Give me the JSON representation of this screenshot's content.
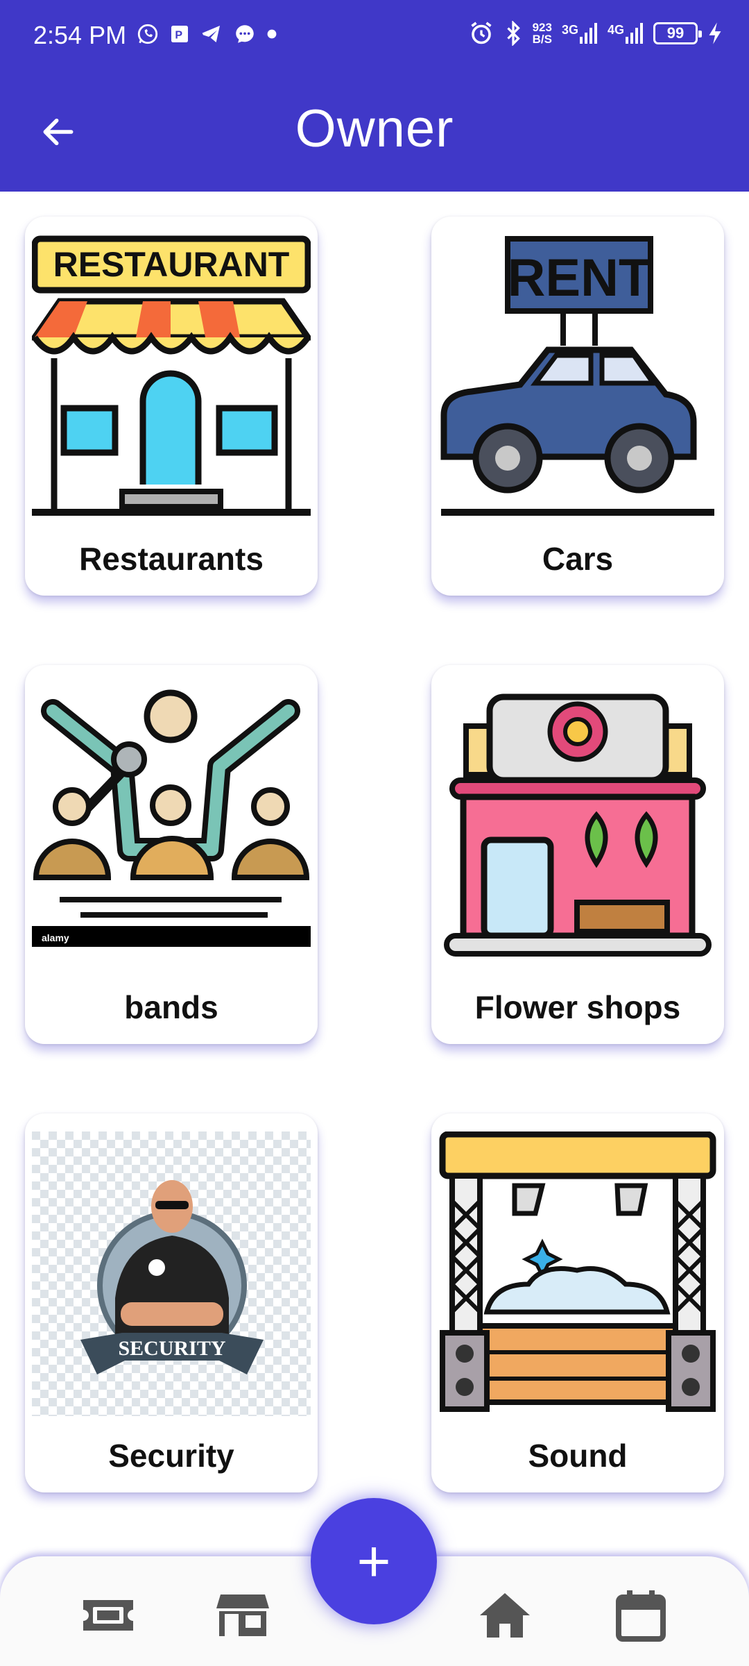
{
  "status_bar": {
    "time": "2:54 PM",
    "net_speed_value": "923",
    "net_speed_unit": "B/S",
    "network_1": "3G",
    "network_2": "4G",
    "battery": "99"
  },
  "app_bar": {
    "title": "Owner",
    "back_icon": "arrow-left-icon"
  },
  "categories": [
    {
      "label": "Restaurants",
      "icon": "restaurant-illustration"
    },
    {
      "label": "Cars",
      "icon": "car-rent-illustration"
    },
    {
      "label": "bands",
      "icon": "band-illustration"
    },
    {
      "label": "Flower shops",
      "icon": "flower-shop-illustration"
    },
    {
      "label": "Security",
      "icon": "security-guard-illustration"
    },
    {
      "label": "Sound",
      "icon": "stage-sound-illustration"
    }
  ],
  "illustration_text": {
    "restaurant_sign": "RESTAURANT",
    "rent_sign": "RENT",
    "security_banner": "SECURITY",
    "band_watermark": "alamy"
  },
  "fab": {
    "label": "+"
  },
  "bottom_nav": [
    {
      "icon": "ticket-icon"
    },
    {
      "icon": "store-icon"
    },
    {
      "icon": "home-icon"
    },
    {
      "icon": "calendar-icon"
    }
  ],
  "colors": {
    "primary": "#4038c8",
    "fab": "#4a40e0",
    "nav_icon": "#555555"
  }
}
